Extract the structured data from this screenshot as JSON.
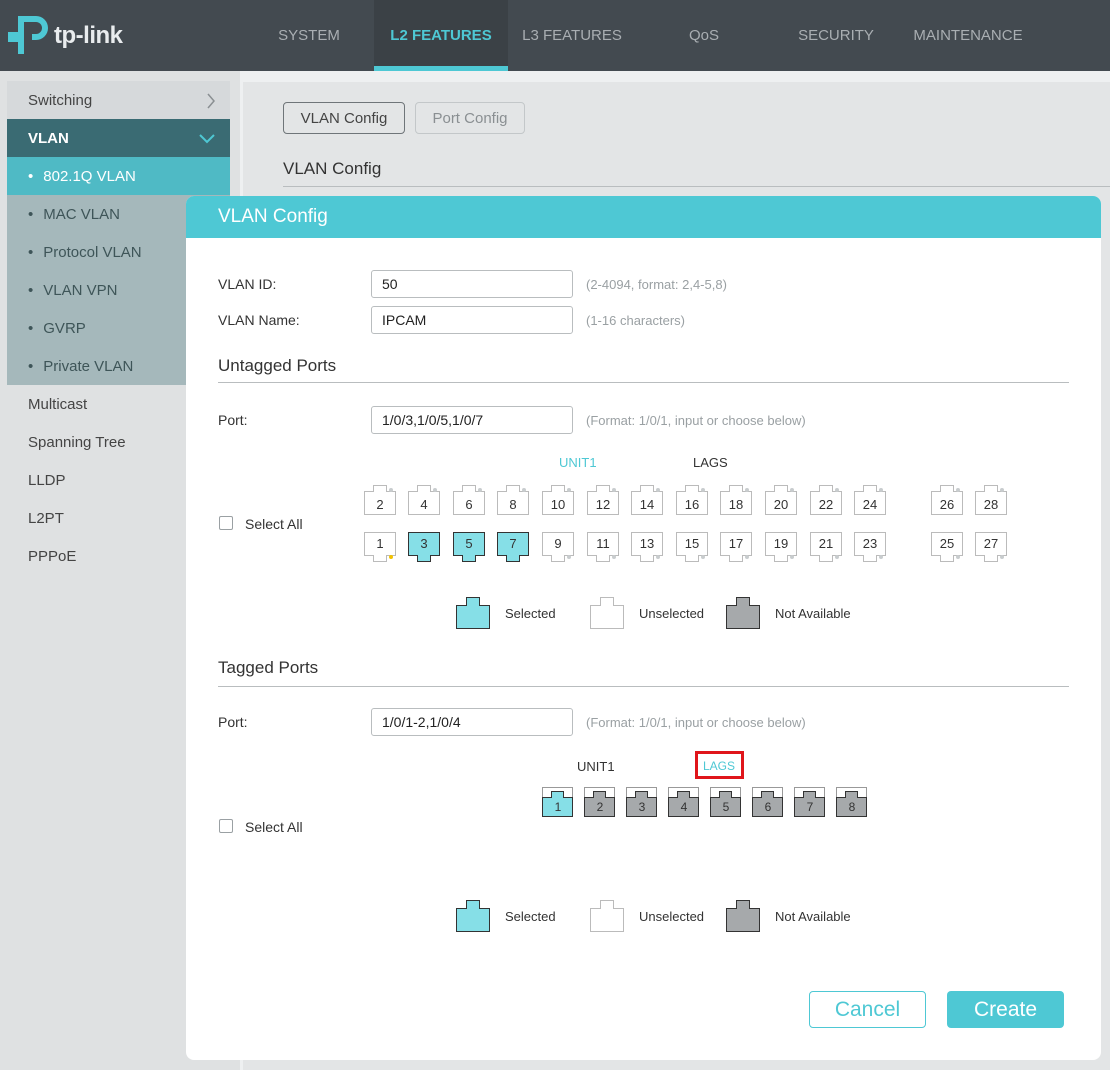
{
  "brand": {
    "logo_text": "tp-link"
  },
  "nav": {
    "tabs": [
      "SYSTEM",
      "L2 FEATURES",
      "L3 FEATURES",
      "QoS",
      "SECURITY",
      "MAINTENANCE"
    ],
    "active_tab": "L2 FEATURES"
  },
  "sidebar": {
    "items": [
      {
        "label": "Switching"
      },
      {
        "label": "VLAN",
        "expanded": true
      },
      {
        "label": "802.1Q VLAN",
        "active": true
      },
      {
        "label": "MAC VLAN"
      },
      {
        "label": "Protocol VLAN"
      },
      {
        "label": "VLAN VPN"
      },
      {
        "label": "GVRP"
      },
      {
        "label": "Private VLAN"
      },
      {
        "label": "Multicast"
      },
      {
        "label": "Spanning Tree"
      },
      {
        "label": "LLDP"
      },
      {
        "label": "L2PT"
      },
      {
        "label": "PPPoE"
      }
    ]
  },
  "background": {
    "tab_vlan_config": "VLAN Config",
    "tab_port_config": "Port Config",
    "title": "VLAN Config"
  },
  "modal": {
    "title": "VLAN Config",
    "vlan_id_label": "VLAN ID:",
    "vlan_id_value": "50",
    "vlan_id_hint": "(2-4094, format: 2,4-5,8)",
    "vlan_name_label": "VLAN Name:",
    "vlan_name_value": "IPCAM",
    "vlan_name_hint": "(1-16 characters)",
    "untagged": {
      "title": "Untagged Ports",
      "port_label": "Port:",
      "port_value": "1/0/3,1/0/5,1/0/7",
      "port_hint": "(Format: 1/0/1, input or choose below)",
      "select_all": "Select All",
      "unit_label": "UNIT1",
      "lags_label": "LAGS",
      "top_ports": [
        "2",
        "4",
        "6",
        "8",
        "10",
        "12",
        "14",
        "16",
        "18",
        "20",
        "22",
        "24",
        "26",
        "28"
      ],
      "bottom_ports": [
        "1",
        "3",
        "5",
        "7",
        "9",
        "11",
        "13",
        "15",
        "17",
        "19",
        "21",
        "23",
        "25",
        "27"
      ],
      "selected": [
        "3",
        "5",
        "7"
      ]
    },
    "tagged": {
      "title": "Tagged Ports",
      "port_label": "Port:",
      "port_value": "1/0/1-2,1/0/4",
      "port_hint": "(Format: 1/0/1, input or choose below)",
      "select_all": "Select All",
      "unit_label": "UNIT1",
      "lags_label": "LAGS",
      "lag_ports": [
        "1",
        "2",
        "3",
        "4",
        "5",
        "6",
        "7",
        "8"
      ],
      "selected": [
        "1"
      ]
    },
    "legend": {
      "selected": "Selected",
      "unselected": "Unselected",
      "not_available": "Not Available"
    },
    "buttons": {
      "cancel": "Cancel",
      "create": "Create"
    }
  },
  "colors": {
    "accent": "#4ec8d4",
    "topbar": "#434a50",
    "highlight": "#e0151b",
    "port_selected": "#86dfe7",
    "port_unavailable": "#a6a9ab"
  }
}
